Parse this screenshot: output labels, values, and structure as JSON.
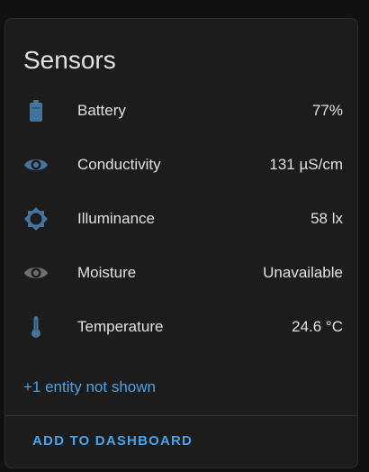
{
  "card": {
    "title": "Sensors",
    "accent_color": "#4aa2e8",
    "icon_color_active": "#44739e",
    "icon_color_unavailable": "#6f6f6f"
  },
  "sensors": [
    {
      "name": "Battery",
      "value": "77%",
      "icon": "battery-icon"
    },
    {
      "name": "Conductivity",
      "value": "131 µS/cm",
      "icon": "eye-icon"
    },
    {
      "name": "Illuminance",
      "value": "58 lx",
      "icon": "brightness-icon"
    },
    {
      "name": "Moisture",
      "value": "Unavailable",
      "icon": "eye-icon"
    },
    {
      "name": "Temperature",
      "value": "24.6 °C",
      "icon": "thermometer-icon"
    }
  ],
  "more_link": "+1 entity not shown",
  "add_button": "ADD TO DASHBOARD"
}
